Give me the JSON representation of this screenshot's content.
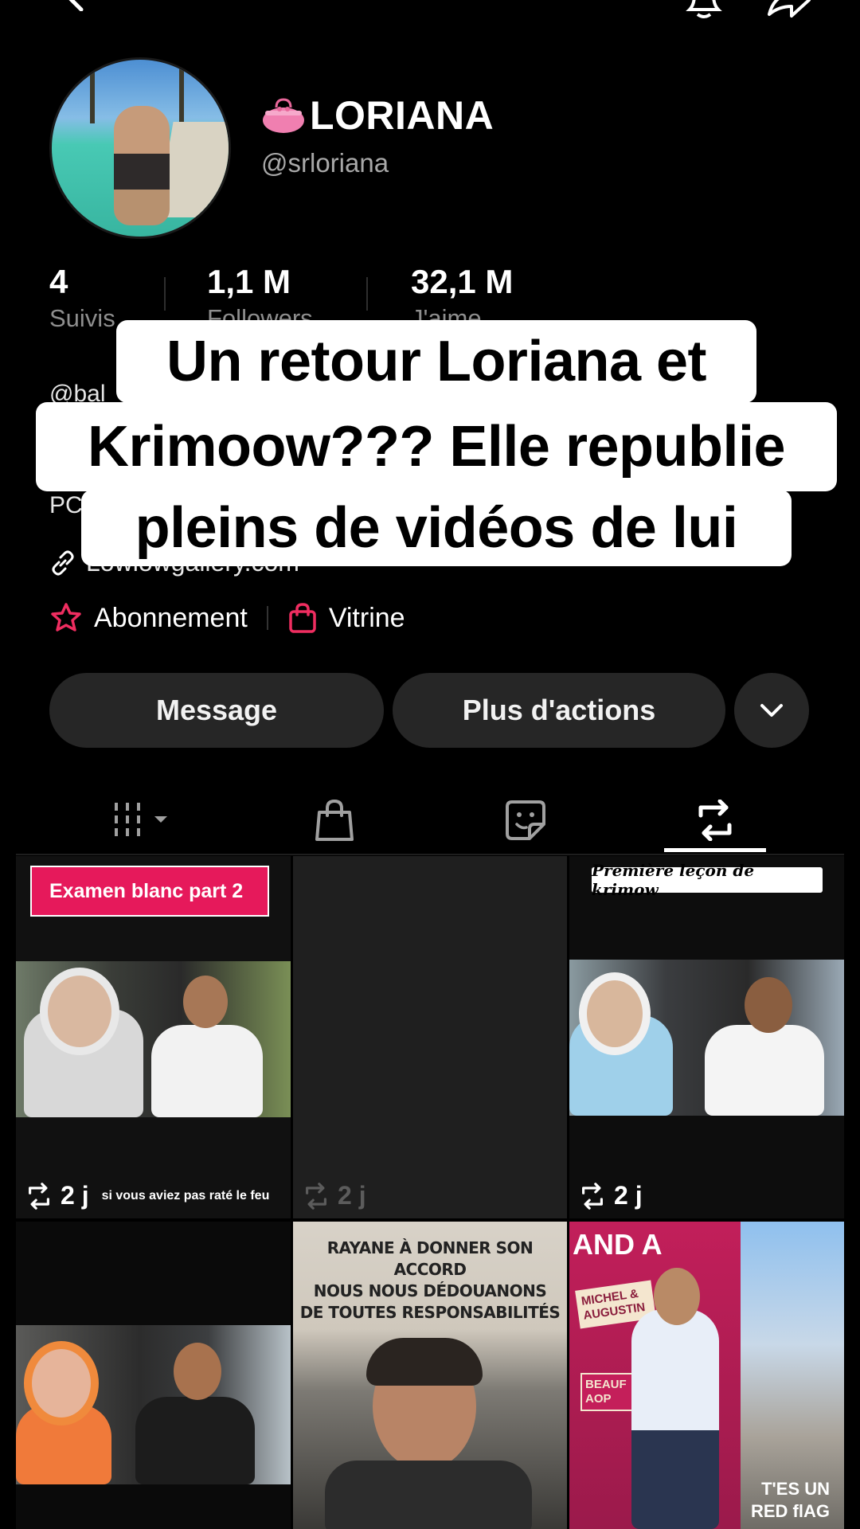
{
  "profile": {
    "display_name": "LORIANA",
    "handle": "@srloriana",
    "stats": [
      {
        "value": "4",
        "label": "Suivis"
      },
      {
        "value": "1,1 M",
        "label": "Followers"
      },
      {
        "value": "32,1 M",
        "label": "J'aime"
      }
    ],
    "bio_line_1": "@bal",
    "bio_line_2": "PC",
    "link_text": "Lowlowgallery.com"
  },
  "quick_links": {
    "subscription": "Abonnement",
    "showcase": "Vitrine"
  },
  "actions": {
    "message": "Message",
    "more_actions": "Plus d'actions"
  },
  "tabs": [
    {
      "name": "videos",
      "icon": "grid-icon"
    },
    {
      "name": "shop",
      "icon": "bag-icon"
    },
    {
      "name": "stickers",
      "icon": "sticker-icon"
    },
    {
      "name": "reposts",
      "icon": "repost-icon",
      "active": true
    }
  ],
  "grid": [
    {
      "tag": "Examen blanc part 2",
      "age": "2 j",
      "caption": "si vous aviez pas raté le feu"
    },
    {
      "age": "2 j"
    },
    {
      "tag": "Première leçon de krimow",
      "age": "2 j"
    },
    {},
    {
      "text_lines": [
        "RAYANE À DONNER SON ACCORD",
        "NOUS NOUS DÉDOUANONS",
        "DE TOUTES RESPONSABILITÉS"
      ]
    },
    {
      "sign_top": "AND A",
      "brand_1": "MICHEL &",
      "brand_2": "AUGUSTIN",
      "brand_3": "BEAUF",
      "brand_4": "AOP",
      "bottom_1": "T'ES UN",
      "bottom_2": "RED flAG"
    }
  ],
  "overlay_caption": {
    "line1": "Un retour Loriana et",
    "line2": "Krimoow??? Elle republie",
    "line3": "pleins de vidéos de lui"
  },
  "colors": {
    "accent_pink": "#e6195b",
    "pill_bg": "#262626",
    "muted_text": "#8e8e8e"
  }
}
